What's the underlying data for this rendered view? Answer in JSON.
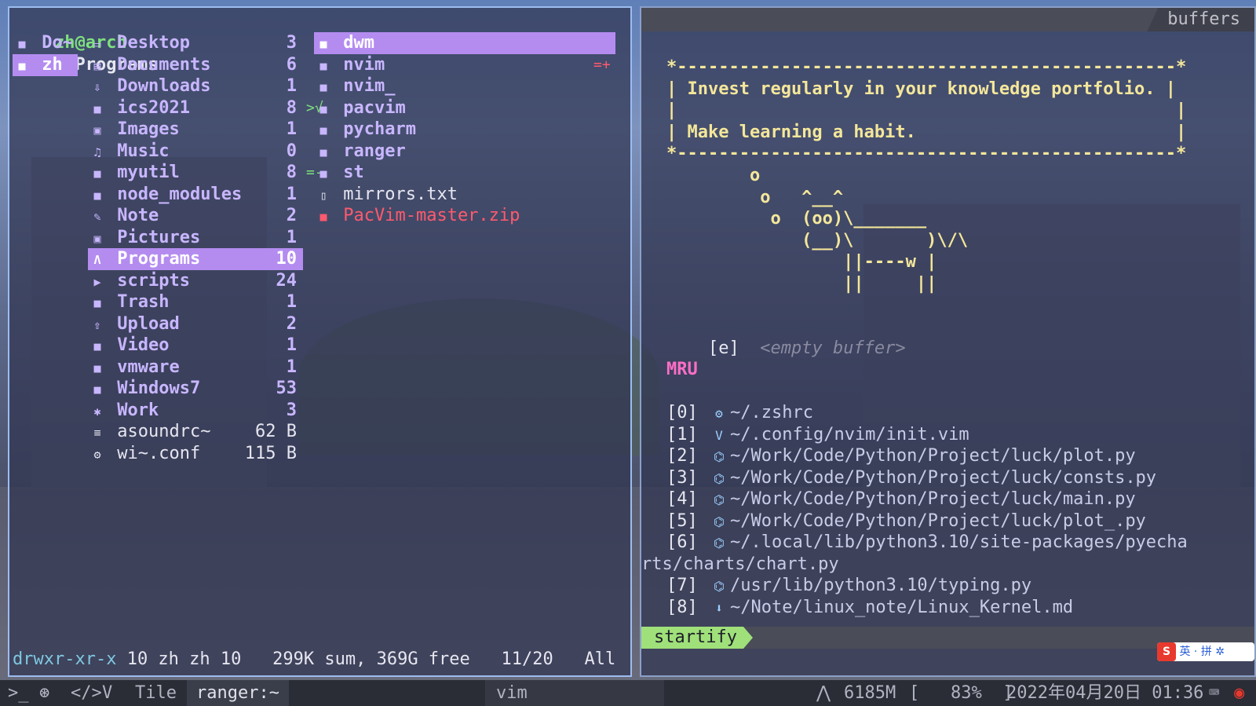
{
  "ranger": {
    "title_user": "zh@arch",
    "title_path": "~/Programs",
    "parent": [
      {
        "label": "Do~",
        "icon": "folder-icon",
        "selected": false
      },
      {
        "label": "zh",
        "icon": "folder-icon",
        "selected": true
      }
    ],
    "current": [
      {
        "name": "Desktop",
        "icon": "desktop-icon",
        "count": "3",
        "git": ""
      },
      {
        "name": "Documents",
        "icon": "document-icon",
        "count": "6",
        "git": ""
      },
      {
        "name": "Downloads",
        "icon": "download-icon",
        "count": "1",
        "git": ""
      },
      {
        "name": "ics2021",
        "icon": "folder-icon",
        "count": "8",
        "git": ">√"
      },
      {
        "name": "Images",
        "icon": "image-icon",
        "count": "1",
        "git": ""
      },
      {
        "name": "Music",
        "icon": "music-icon",
        "count": "0",
        "git": ""
      },
      {
        "name": "myutil",
        "icon": "folder-icon",
        "count": "8",
        "git": "=-"
      },
      {
        "name": "node_modules",
        "icon": "folder-icon",
        "count": "1",
        "git": ""
      },
      {
        "name": "Note",
        "icon": "note-icon",
        "count": "2",
        "git": ""
      },
      {
        "name": "Pictures",
        "icon": "image-icon",
        "count": "1",
        "git": ""
      },
      {
        "name": "Programs",
        "icon": "code-icon",
        "count": "10",
        "git": "",
        "selected": true
      },
      {
        "name": "scripts",
        "icon": "terminal-icon",
        "count": "24",
        "git": ""
      },
      {
        "name": "Trash",
        "icon": "folder-icon",
        "count": "1",
        "git": ""
      },
      {
        "name": "Upload",
        "icon": "upload-icon",
        "count": "2",
        "git": ""
      },
      {
        "name": "Video",
        "icon": "video-icon",
        "count": "1",
        "git": ""
      },
      {
        "name": "vmware",
        "icon": "folder-icon",
        "count": "1",
        "git": ""
      },
      {
        "name": "Windows7",
        "icon": "folder-icon",
        "count": "53",
        "git": ""
      },
      {
        "name": "Work",
        "icon": "work-icon",
        "count": "3",
        "git": ""
      },
      {
        "name": "asoundrc~",
        "icon": "text-file-icon",
        "count": "62 B",
        "git": "",
        "file": true
      },
      {
        "name": "wi~.conf",
        "icon": "gear-icon",
        "count": "115 B",
        "git": "",
        "file": true
      }
    ],
    "preview": [
      {
        "name": "dwm",
        "icon": "folder-icon",
        "selected": true,
        "git": ""
      },
      {
        "name": "nvim",
        "icon": "folder-icon",
        "git": "=+"
      },
      {
        "name": "nvim_",
        "icon": "folder-icon",
        "git": ""
      },
      {
        "name": "pacvim",
        "icon": "folder-icon",
        "git": ""
      },
      {
        "name": "pycharm",
        "icon": "folder-icon",
        "git": ""
      },
      {
        "name": "ranger",
        "icon": "folder-icon",
        "git": ""
      },
      {
        "name": "st",
        "icon": "folder-icon",
        "git": ""
      },
      {
        "name": "mirrors.txt",
        "icon": "file-icon",
        "git": "",
        "kind": "file"
      },
      {
        "name": "PacVim-master.zip",
        "icon": "archive-icon",
        "git": "",
        "kind": "zip"
      }
    ],
    "status": {
      "perm": "drwxr-xr-x",
      "rest": " 10 zh zh 10   299K sum, 369G free   11/20   All"
    }
  },
  "vim": {
    "tab": "buffers",
    "quote_border": "*------------------------------------------------*",
    "quote_line1": "| Invest regularly in your knowledge portfolio. |",
    "quote_blank": "|                                                |",
    "quote_line2": "| Make learning a habit.                         |",
    "cow": [
      "        o",
      "         o   ^__^",
      "          o  (oo)\\_______",
      "             (__)\\       )\\/\\",
      "                 ||----w |",
      "                 ||     ||"
    ],
    "empty_key": "[e]",
    "empty_label": "<empty buffer>",
    "mru_header": "MRU",
    "mru": [
      {
        "idx": "[0]",
        "icon": "gear-icon",
        "path": "~/.zshrc"
      },
      {
        "idx": "[1]",
        "icon": "vim-icon",
        "path": "~/.config/nvim/init.vim"
      },
      {
        "idx": "[2]",
        "icon": "python-icon",
        "path": "~/Work/Code/Python/Project/luck/plot.py"
      },
      {
        "idx": "[3]",
        "icon": "python-icon",
        "path": "~/Work/Code/Python/Project/luck/consts.py"
      },
      {
        "idx": "[4]",
        "icon": "python-icon",
        "path": "~/Work/Code/Python/Project/luck/main.py"
      },
      {
        "idx": "[5]",
        "icon": "python-icon",
        "path": "~/Work/Code/Python/Project/luck/plot_.py"
      },
      {
        "idx": "[6]",
        "icon": "python-icon",
        "path": "~/.local/lib/python3.10/site-packages/pyecha"
      },
      {
        "idx": "",
        "icon": "",
        "path": "rts/charts/chart.py",
        "wrap": true
      },
      {
        "idx": "[7]",
        "icon": "python-icon",
        "path": "/usr/lib/python3.10/typing.py"
      },
      {
        "idx": "[8]",
        "icon": "markdown-icon",
        "path": "~/Note/linux_note/Linux_Kernel.md"
      }
    ],
    "statusline": "startify"
  },
  "taskbar": {
    "layout": "Tile",
    "window_title": "ranger:~",
    "vim_tab": "vim",
    "memory": "6185M",
    "battery": "[   83%  ]",
    "datetime": "2022年04月20日 01:36"
  },
  "ime": {
    "lang": "英",
    "punct": "·",
    "mode": "拼"
  },
  "colors": {
    "accent": "#b48cf0",
    "border": "#9dbcf0",
    "quote": "#f4e79a",
    "mru": "#ff6ec7",
    "startify": "#9fe07a"
  }
}
